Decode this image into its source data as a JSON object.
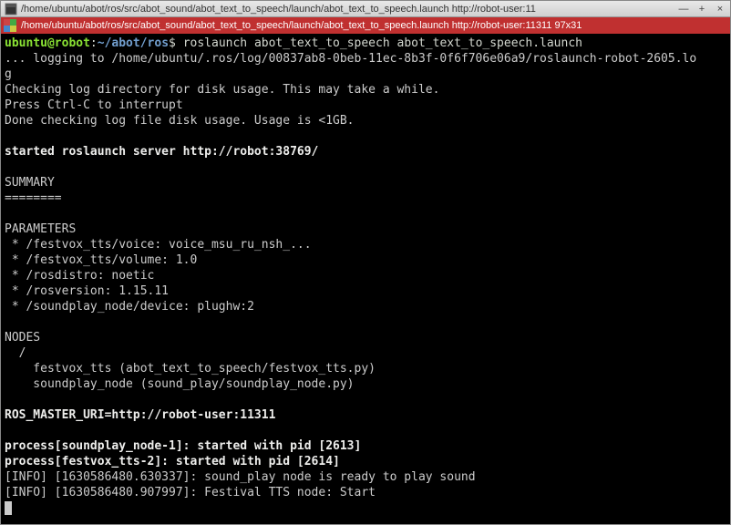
{
  "window": {
    "title": "/home/ubuntu/abot/ros/src/abot_sound/abot_text_to_speech/launch/abot_text_to_speech.launch http://robot-user:11"
  },
  "tab": {
    "title": "/home/ubuntu/abot/ros/src/abot_sound/abot_text_to_speech/launch/abot_text_to_speech.launch http://robot-user:11311 97x31"
  },
  "prompt": {
    "user_host": "ubuntu@robot",
    "colon": ":",
    "path": "~/abot/ros",
    "dollar": "$ ",
    "command": "roslaunch abot_text_to_speech abot_text_to_speech.launch"
  },
  "lines": {
    "l1": "... logging to /home/ubuntu/.ros/log/00837ab8-0beb-11ec-8b3f-0f6f706e06a9/roslaunch-robot-2605.lo",
    "l2": "g",
    "l3": "Checking log directory for disk usage. This may take a while.",
    "l4": "Press Ctrl-C to interrupt",
    "l5": "Done checking log file disk usage. Usage is <1GB.",
    "l6": "",
    "l7": "started roslaunch server http://robot:38769/",
    "l8": "",
    "l9": "SUMMARY",
    "l10": "========",
    "l11": "",
    "l12": "PARAMETERS",
    "l13": " * /festvox_tts/voice: voice_msu_ru_nsh_...",
    "l14": " * /festvox_tts/volume: 1.0",
    "l15": " * /rosdistro: noetic",
    "l16": " * /rosversion: 1.15.11",
    "l17": " * /soundplay_node/device: plughw:2",
    "l18": "",
    "l19": "NODES",
    "l20": "  /",
    "l21": "    festvox_tts (abot_text_to_speech/festvox_tts.py)",
    "l22": "    soundplay_node (sound_play/soundplay_node.py)",
    "l23": "",
    "l24": "ROS_MASTER_URI=http://robot-user:11311",
    "l25": "",
    "l26": "process[soundplay_node-1]: started with pid [2613]",
    "l27": "process[festvox_tts-2]: started with pid [2614]",
    "l28": "[INFO] [1630586480.630337]: sound_play node is ready to play sound",
    "l29": "[INFO] [1630586480.907997]: Festival TTS node: Start"
  },
  "controls": {
    "minimize": "—",
    "maximize": "+",
    "close": "×"
  }
}
